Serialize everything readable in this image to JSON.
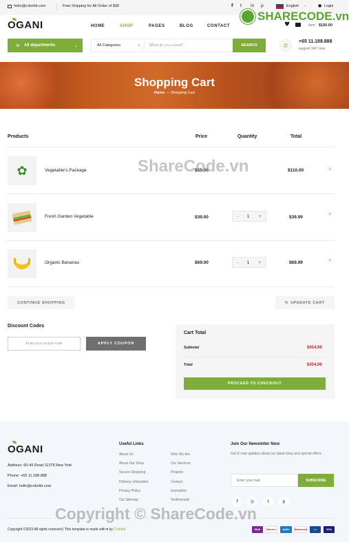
{
  "topbar": {
    "email": "hello@colorlib.com",
    "shipping": "Free Shipping for All Order of $99",
    "language": "English",
    "login": "Login"
  },
  "header": {
    "logo": "OGANI",
    "nav": [
      "HOME",
      "SHOP",
      "PAGES",
      "BLOG",
      "CONTACT"
    ],
    "active_nav": "SHOP",
    "cart_item_label": "item:",
    "cart_total": "$150.00"
  },
  "search": {
    "departments_label": "All departments",
    "category_label": "All Categories",
    "placeholder": "What do yo u need?",
    "button": "SEARCH",
    "phone": "+65 11.188.888",
    "support": "support 24/7 time"
  },
  "hero": {
    "title": "Shopping Cart",
    "breadcrumb_home": "Home",
    "breadcrumb_current": "Shopping Cart"
  },
  "cart": {
    "headers": [
      "Products",
      "Price",
      "Quantity",
      "Total"
    ],
    "rows": [
      {
        "name": "Vegetable’s Package",
        "price": "$55.00",
        "qty": "",
        "total": "$110.00"
      },
      {
        "name": "Fresh Garden Vegetable",
        "price": "$39.00",
        "qty": "1",
        "total": "$39.99"
      },
      {
        "name": "Organic Bananas",
        "price": "$69.00",
        "qty": "1",
        "total": "$69.99"
      }
    ],
    "continue_btn": "CONTINUE SHOPPING",
    "update_btn": "UPADATE CART"
  },
  "discount": {
    "title": "Discount Codes",
    "placeholder": "Enter your coupon code",
    "button": "APPLY COUPON"
  },
  "cart_total": {
    "title": "Cart Total",
    "subtotal_label": "Subtotal",
    "subtotal_value": "$454.98",
    "total_label": "Total",
    "total_value": "$454.98",
    "checkout_btn": "PROCEED TO CHECKOUT"
  },
  "footer": {
    "logo": "OGANI",
    "address": "Address: 60-49 Road 11378 New York",
    "phone": "Phone: +65 11.188.888",
    "email": "Email: hello@colorlib.com",
    "links_title": "Useful Links",
    "links_col1": [
      "About Us",
      "About Our Shop",
      "Secure Shopping",
      "Delivery infomation",
      "Privacy Policy",
      "Our Sitemap"
    ],
    "links_col2": [
      "Who We Are",
      "Our Services",
      "Projects",
      "Contact",
      "Innovation",
      "Testimonials"
    ],
    "newsletter_title": "Join Our Newsletter Now",
    "newsletter_text": "Get E-mail updates about our latest shop and special offers.",
    "newsletter_placeholder": "Enter your mail",
    "newsletter_btn": "SUBSCRIBE",
    "copyright": "Copyright ©2023 All rights reserved | This template is made with",
    "copyright_by": "by",
    "copyright_author": "Colorlib",
    "payments": [
      "Skrill",
      "Maestro",
      "AmEx",
      "Mastercard",
      "VISA"
    ]
  },
  "watermark": {
    "brand": "SHARECODE.vn",
    "center": "ShareCode.vn",
    "copyright": "Copyright © ShareCode.vn"
  },
  "colors": {
    "accent": "#7fad39",
    "price_red": "#dd2222",
    "dark_button": "#6f6f6f"
  }
}
